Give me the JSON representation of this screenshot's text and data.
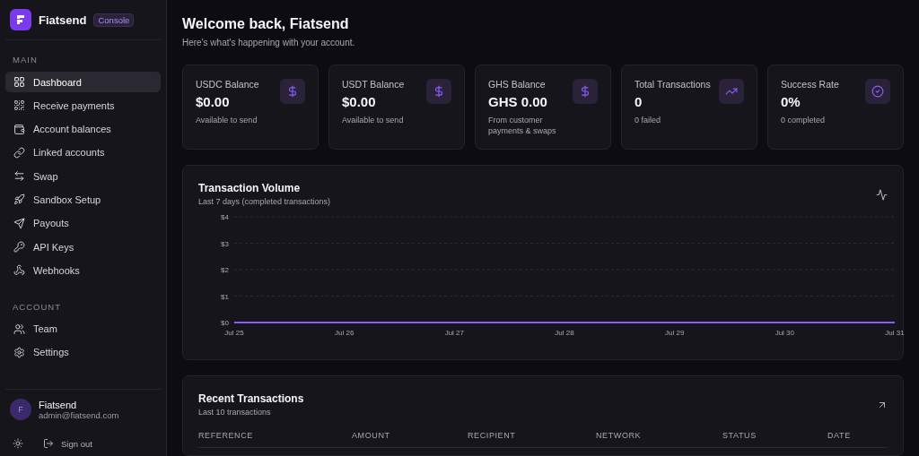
{
  "brand": {
    "name": "Fiatsend",
    "badge": "Console"
  },
  "sidebar": {
    "sections": [
      {
        "title": "MAIN",
        "items": [
          {
            "label": "Dashboard",
            "selected": true
          },
          {
            "label": "Receive payments",
            "selected": false
          },
          {
            "label": "Account balances",
            "selected": false
          },
          {
            "label": "Linked accounts",
            "selected": false
          },
          {
            "label": "Swap",
            "selected": false
          },
          {
            "label": "Sandbox Setup",
            "selected": false
          },
          {
            "label": "Payouts",
            "selected": false
          },
          {
            "label": "API Keys",
            "selected": false
          },
          {
            "label": "Webhooks",
            "selected": false
          }
        ]
      },
      {
        "title": "ACCOUNT",
        "items": [
          {
            "label": "Team",
            "selected": false
          },
          {
            "label": "Settings",
            "selected": false
          }
        ]
      }
    ]
  },
  "user": {
    "initial": "F",
    "name": "Fiatsend",
    "email": "admin@fiatsend.com"
  },
  "sign_out": "Sign out",
  "header": {
    "title": "Welcome back, Fiatsend",
    "subtitle": "Here's what's happening with your account."
  },
  "stats": [
    {
      "label": "USDC Balance",
      "value": "$0.00",
      "note": "Available to send"
    },
    {
      "label": "USDT Balance",
      "value": "$0.00",
      "note": "Available to send"
    },
    {
      "label": "GHS Balance",
      "value": "GHS 0.00",
      "note": "From customer payments & swaps"
    },
    {
      "label": "Total Transactions",
      "value": "0",
      "note": "0 failed"
    },
    {
      "label": "Success Rate",
      "value": "0%",
      "note": "0 completed"
    }
  ],
  "volume": {
    "title": "Transaction Volume",
    "subtitle": "Last 7 days (completed transactions)",
    "chart_data": {
      "type": "line",
      "categories": [
        "Jul 25",
        "Jul 26",
        "Jul 27",
        "Jul 28",
        "Jul 29",
        "Jul 30",
        "Jul 31"
      ],
      "series": [
        {
          "color": "#8b5cf6",
          "values": [
            0,
            0,
            0,
            0,
            0,
            0,
            0
          ]
        }
      ],
      "grid": true,
      "ylim": [
        0,
        4
      ],
      "yticks": [
        {
          "value": 0,
          "label": "$0"
        },
        {
          "value": 1,
          "label": "$1"
        },
        {
          "value": 2,
          "label": "$2"
        },
        {
          "value": 3,
          "label": "$3"
        },
        {
          "value": 4,
          "label": "$4"
        }
      ]
    }
  },
  "recent": {
    "title": "Recent Transactions",
    "subtitle": "Last 10 transactions",
    "columns": [
      "REFERENCE",
      "AMOUNT",
      "RECIPIENT",
      "NETWORK",
      "STATUS",
      "DATE"
    ]
  }
}
